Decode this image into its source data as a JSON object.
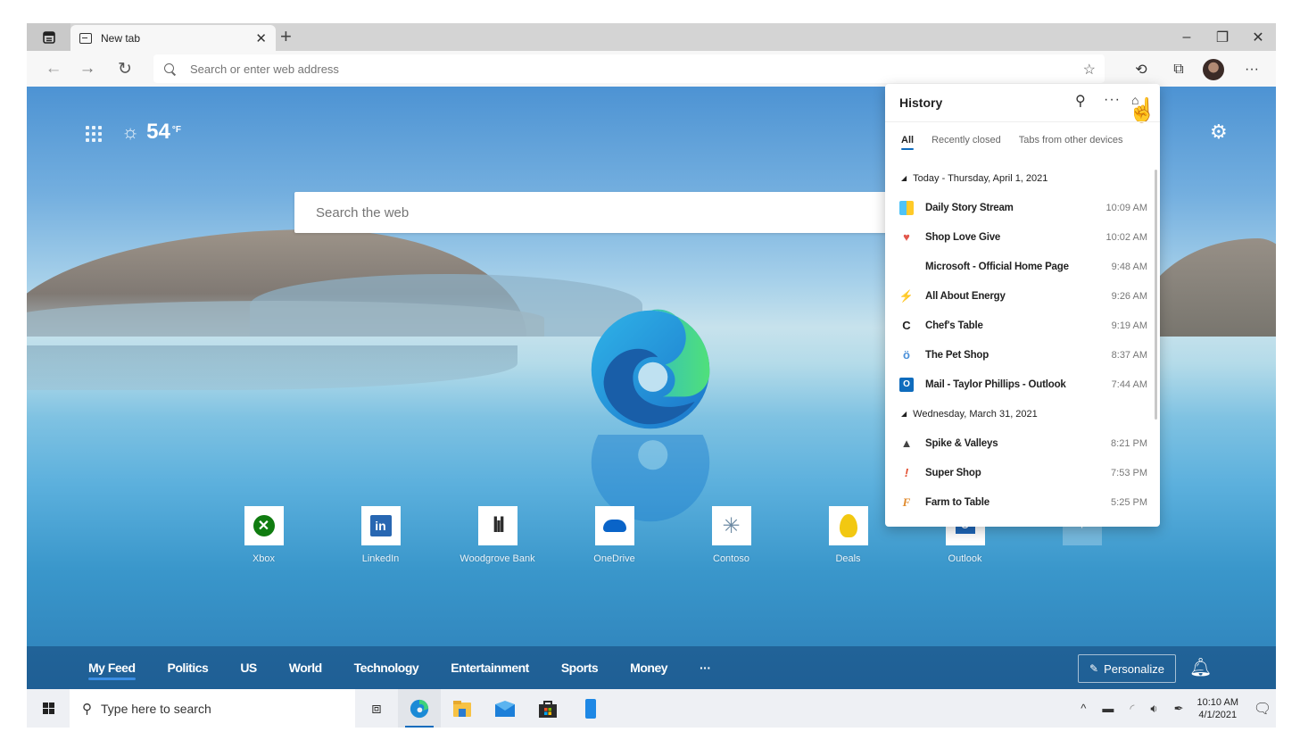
{
  "browser": {
    "tab": {
      "title": "New tab",
      "favicon": "newtab-icon"
    },
    "window_controls": {
      "minimize": "–",
      "restore": "❐",
      "close": "✕"
    },
    "address_bar": {
      "placeholder": "Search or enter web address",
      "value": ""
    },
    "toolbar_icons": [
      "add-favorite-icon",
      "history-icon",
      "collections-icon",
      "profile-avatar",
      "more-icon"
    ]
  },
  "newtab": {
    "weather": {
      "temperature": "54",
      "unit": "°F",
      "icon": "sun-icon"
    },
    "search": {
      "placeholder": "Search the web"
    },
    "quick_links": [
      {
        "label": "Xbox",
        "icon": "xbox-icon"
      },
      {
        "label": "LinkedIn",
        "icon": "linkedin-icon"
      },
      {
        "label": "Woodgrove Bank",
        "icon": "woodgrove-bank-icon"
      },
      {
        "label": "OneDrive",
        "icon": "onedrive-icon"
      },
      {
        "label": "Contoso",
        "icon": "contoso-icon"
      },
      {
        "label": "Deals",
        "icon": "deals-icon"
      },
      {
        "label": "Outlook",
        "icon": "outlook-icon"
      },
      {
        "label": "",
        "icon": "add-site-icon"
      }
    ],
    "news_tabs": [
      {
        "label": "My Feed",
        "active": true
      },
      {
        "label": "Politics"
      },
      {
        "label": "US"
      },
      {
        "label": "World"
      },
      {
        "label": "Technology"
      },
      {
        "label": "Entertainment"
      },
      {
        "label": "Sports"
      },
      {
        "label": "Money"
      },
      {
        "label": "···"
      }
    ],
    "personalize_label": "Personalize"
  },
  "history": {
    "title": "History",
    "tabs": [
      {
        "label": "All",
        "active": true
      },
      {
        "label": "Recently closed"
      },
      {
        "label": "Tabs from other devices"
      }
    ],
    "groups": [
      {
        "label": "Today - Thursday, April 1, 2021",
        "items": [
          {
            "name": "Daily Story Stream",
            "time": "10:09 AM",
            "favicon": "daily-story-icon"
          },
          {
            "name": "Shop Love Give",
            "time": "10:02 AM",
            "favicon": "heart-icon"
          },
          {
            "name": "Microsoft - Official Home Page",
            "time": "9:48 AM",
            "favicon": "microsoft-icon"
          },
          {
            "name": "All About Energy",
            "time": "9:26 AM",
            "favicon": "lightning-icon"
          },
          {
            "name": "Chef's Table",
            "time": "9:19 AM",
            "favicon": "chef-icon"
          },
          {
            "name": "The Pet Shop",
            "time": "8:37 AM",
            "favicon": "pet-icon"
          },
          {
            "name": "Mail - Taylor Phillips - Outlook",
            "time": "7:44 AM",
            "favicon": "outlook-icon"
          }
        ]
      },
      {
        "label": "Wednesday, March 31, 2021",
        "items": [
          {
            "name": "Spike & Valleys",
            "time": "8:21 PM",
            "favicon": "spike-icon"
          },
          {
            "name": "Super Shop",
            "time": "7:53 PM",
            "favicon": "exclamation-icon"
          },
          {
            "name": "Farm to Table",
            "time": "5:25 PM",
            "favicon": "farm-icon"
          }
        ]
      }
    ]
  },
  "taskbar": {
    "search_placeholder": "Type here to search",
    "apps": [
      "task-view-icon",
      "edge-icon",
      "file-explorer-icon",
      "mail-icon",
      "store-icon",
      "phone-icon"
    ],
    "clock": {
      "time": "10:10 AM",
      "date": "4/1/2021"
    }
  }
}
